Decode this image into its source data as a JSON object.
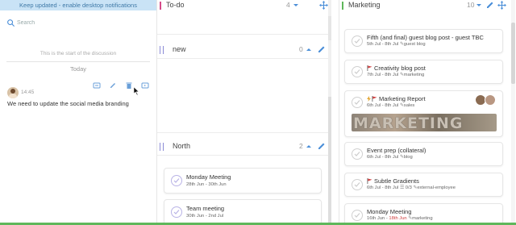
{
  "chat": {
    "notification": "Keep updated - enable desktop notifications",
    "search_placeholder": "Search",
    "start_text": "This is the start of the discussion",
    "day_label": "Today",
    "message": {
      "time": "14:45",
      "text": "We need to update the social media branding"
    }
  },
  "columns": [
    {
      "title": "To-do",
      "count": "4",
      "color": "#d64a8a"
    },
    {
      "title": "Marketing",
      "count": "10",
      "color": "#5fb75b"
    }
  ],
  "todo": {
    "groups": [
      {
        "title": "new",
        "count": "0",
        "cards": []
      },
      {
        "title": "North",
        "count": "2",
        "cards": [
          {
            "title": "Monday Meeting",
            "dates": "28th Jun - 30th Jun"
          },
          {
            "title": "Team meeting",
            "dates": "30th Jun - 2nd Jul"
          }
        ]
      }
    ]
  },
  "marketing_cards": [
    {
      "title": "Fifth (and final) guest blog post - guest TBC",
      "dates": "5th Jul - 8th Jul",
      "tag": "guest blog"
    },
    {
      "title": "Creativity blog post",
      "dates": "7th Jul - 8th Jul",
      "tag": "marketing",
      "flag": "#d04040"
    },
    {
      "title": "Marketing Report",
      "dates": "6th Jul - 8th Jul",
      "tag": "sales",
      "flag": "#d04040",
      "banner_text": "MARKETING"
    },
    {
      "title": "Event prep (collateral)",
      "dates": "6th Jul - 8th Jul",
      "tag": "blog"
    },
    {
      "title": "Subtle Gradients",
      "dates": "6th Jul - 8th Jul",
      "checklist": "0/3",
      "tag": "external-employee",
      "flag": "#d04040"
    },
    {
      "title": "Monday Meeting",
      "dates_start": "16th Jun - ",
      "dates_end": "18th Jun",
      "tag": "marketing"
    }
  ],
  "colors": {
    "accent": "#4a8ed8",
    "notify_bg": "#c9e3f6",
    "green": "#5fb75b",
    "purple": "#8b8bd6"
  },
  "icons": [
    "search-icon",
    "reply-icon",
    "edit-icon",
    "delete-icon",
    "forward-icon",
    "caret-up-icon",
    "move-icon",
    "pencil-icon",
    "check-icon",
    "flag-icon",
    "bolt-icon",
    "tag-icon",
    "checklist-icon"
  ]
}
